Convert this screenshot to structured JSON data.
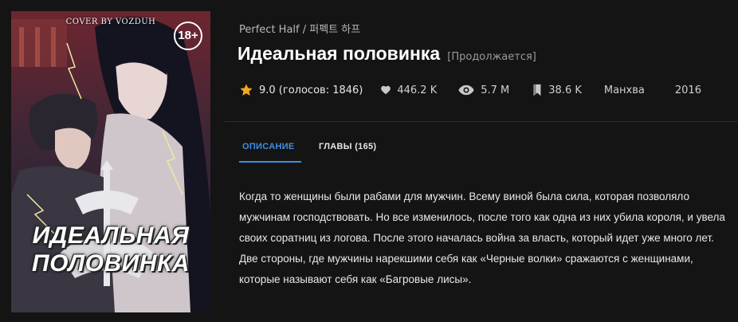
{
  "cover": {
    "credit": "COVER BY VOZDUH",
    "age_rating": "18+",
    "title_line1": "ИДЕАЛЬНАЯ",
    "title_line2": "ПОЛОВИНКА"
  },
  "manga": {
    "alt_name": "Perfect Half / 퍼펙트 하프",
    "title": "Идеальная половинка",
    "status": "[Продолжается]"
  },
  "stats": {
    "rating": "9.0 (голосов: 1846)",
    "likes": "446.2 K",
    "views": "5.7 M",
    "bookmarks": "38.6 K",
    "type": "Манхва",
    "year": "2016"
  },
  "tabs": [
    {
      "label": "ОПИСАНИЕ",
      "active": true
    },
    {
      "label": "ГЛАВЫ (165)",
      "active": false
    }
  ],
  "description": "Когда то женщины были рабами для мужчин. Всему виной была сила, которая позволяло мужчинам господствовать. Но все изменилось, после того как одна из них убила короля, и увела своих соратниц из логова.  После этого началась война за власть, который идет уже много лет. Две стороны, где мужчины нарекшими себя как «Черные волки» сражаются с женщинами, которые называют  себя как «Багровые лисы».",
  "colors": {
    "accent": "#3d8fe0",
    "star": "#f5a623",
    "background": "#141414"
  }
}
